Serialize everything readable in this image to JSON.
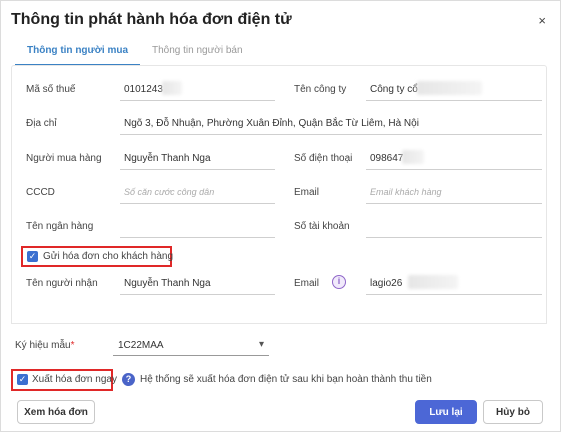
{
  "dialog": {
    "title": "Thông tin phát hành hóa đơn điện tử",
    "close_glyph": "×"
  },
  "tabs": [
    {
      "label": "Thông tin người mua",
      "active": true
    },
    {
      "label": "Thông tin người bán",
      "active": false
    }
  ],
  "buyer": {
    "tax_code": {
      "label": "Mã số thuế",
      "value": "0101243"
    },
    "company": {
      "label": "Tên công ty",
      "value": "Công ty cổ"
    },
    "address": {
      "label": "Địa chỉ",
      "value": "Ngõ 3, Đỗ Nhuận, Phường Xuân Đỉnh, Quận Bắc Từ Liêm, Hà Nội"
    },
    "buyer_name": {
      "label": "Người mua hàng",
      "value": "Nguyễn Thanh Nga"
    },
    "phone": {
      "label": "Số điện thoại",
      "value": "098647"
    },
    "id_card": {
      "label": "CCCD",
      "placeholder": "Số căn cước công dân"
    },
    "email": {
      "label": "Email",
      "placeholder": "Email khách hàng"
    },
    "bank_name": {
      "label": "Tên ngân hàng",
      "value": ""
    },
    "account_no": {
      "label": "Số tài khoản",
      "value": ""
    },
    "send_invoice": {
      "label": "Gửi hóa đơn cho khách hàng",
      "checked": true
    },
    "recipient": {
      "label": "Tên người nhận",
      "value": "Nguyễn Thanh Nga"
    },
    "recipient_email": {
      "label": "Email",
      "value": "lagio26",
      "info_glyph": "i"
    }
  },
  "template": {
    "label": "Ký hiệu mẫu",
    "required_mark": "*",
    "value": "1C22MAA",
    "chevron": "▾"
  },
  "export": {
    "label": "Xuất hóa đơn ngay",
    "checked": true,
    "help_glyph": "?",
    "hint": "Hệ thống sẽ xuất hóa đơn điện tử sau khi bạn hoàn thành thu tiền"
  },
  "footer": {
    "view_label": "Xem hóa đơn",
    "save_label": "Lưu lại",
    "cancel_label": "Hủy bỏ"
  },
  "colors": {
    "accent": "#3b82c4",
    "primary_button": "#4c67d6",
    "highlight_border": "#e02828"
  }
}
